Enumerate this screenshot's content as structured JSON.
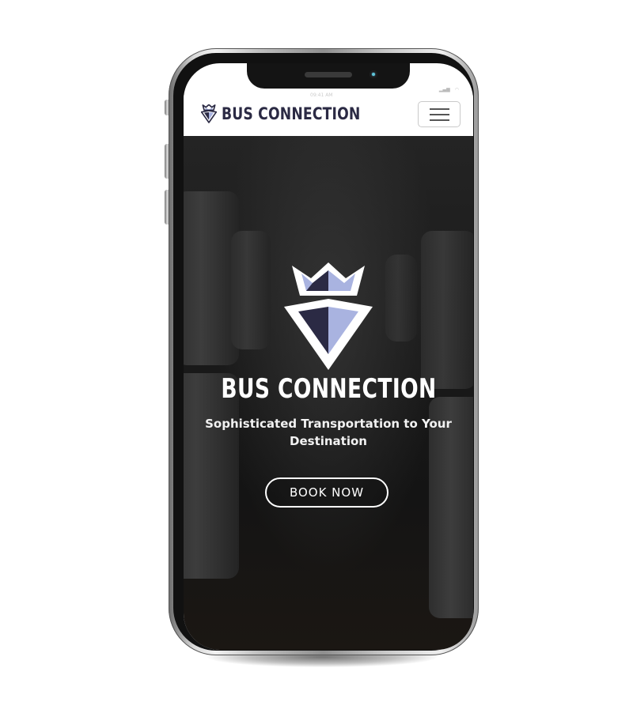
{
  "brand": {
    "name": "BUS CONNECTION",
    "color": "#2b2a44",
    "accent": "#a9b3e0"
  },
  "status_bar": {
    "time": "09:41 AM",
    "signal": "▂▄▆",
    "wifi": "◠"
  },
  "nav": {
    "menu_icon": "hamburger-icon"
  },
  "hero": {
    "title": "BUS CONNECTION",
    "subtitle": "Sophisticated Transportation to Your Destination",
    "cta_label": "BOOK NOW"
  }
}
